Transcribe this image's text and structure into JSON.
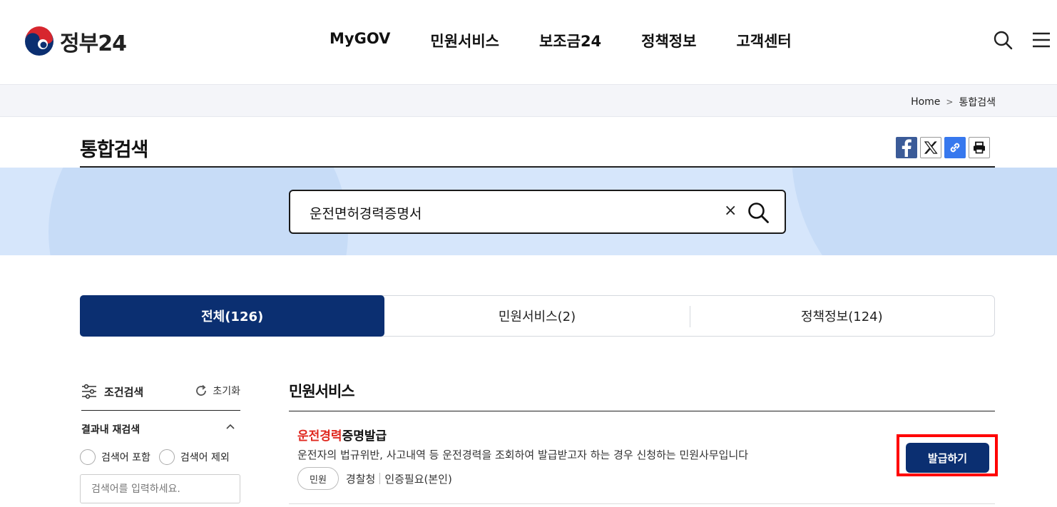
{
  "header": {
    "logo_text": "정부24",
    "nav": [
      "MyGOV",
      "민원서비스",
      "보조금24",
      "정책정보",
      "고객센터"
    ]
  },
  "breadcrumb": {
    "home": "Home",
    "current": "통합검색"
  },
  "page": {
    "title": "통합검색"
  },
  "search": {
    "query": "운전면허경력증명서",
    "clear": "×"
  },
  "tabs": [
    {
      "label": "전체(126)",
      "active": true
    },
    {
      "label": "민원서비스(2)",
      "active": false
    },
    {
      "label": "정책정보(124)",
      "active": false
    }
  ],
  "sidebar": {
    "title": "조건검색",
    "reset": "초기화",
    "subsearch_title": "결과내 재검색",
    "include_label": "검색어 포함",
    "exclude_label": "검색어 제외",
    "input_placeholder": "검색어를 입력하세요."
  },
  "results": {
    "section_title": "민원서비스",
    "items": [
      {
        "title_highlight": "운전경력",
        "title_rest": "증명발급",
        "description": "운전자의 법규위반, 사고내역 등 운전경력을 조회하여 발급받고자 하는 경우 신청하는 민원사무입니다",
        "tag": "민원",
        "agency": "경찰청",
        "auth": "인증필요(본인)",
        "button": "발급하기"
      }
    ]
  },
  "colors": {
    "navy": "#0b2f71",
    "highlight": "#e0281f",
    "banner": "#d6e6fb",
    "focus_box": "#ff0000"
  }
}
